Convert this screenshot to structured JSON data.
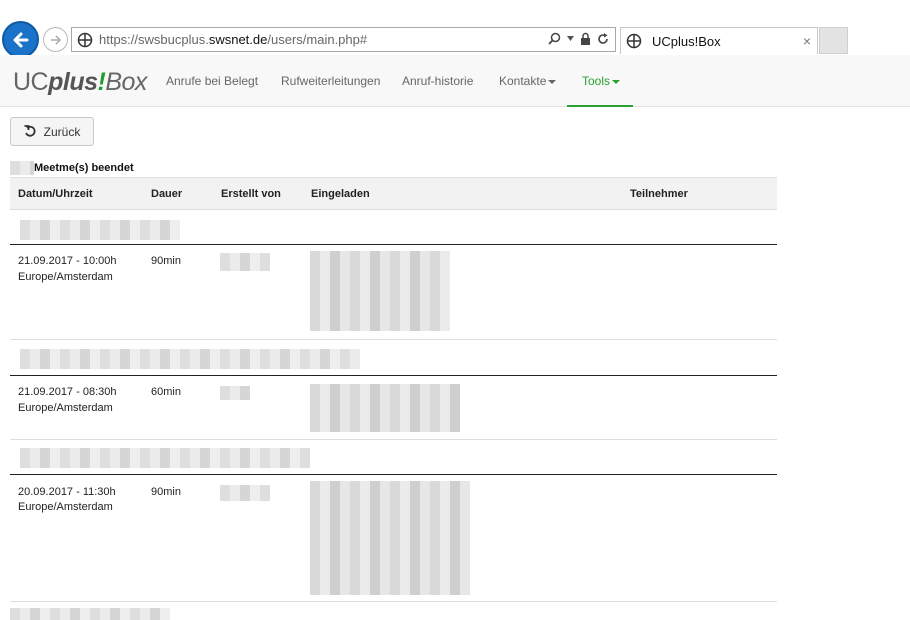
{
  "browser": {
    "url_prefix": "https://swsbucplus.",
    "url_host": "swsnet.de",
    "url_path": "/users/main.php#",
    "tab_title": "UCplus!Box",
    "tab_close": "×"
  },
  "brand": {
    "uc": "UC",
    "plus": "plus",
    "bang": "!",
    "box": "Box"
  },
  "menu": {
    "items": [
      {
        "label": "Anrufe bei Belegt"
      },
      {
        "label": "Rufweiterleitungen"
      },
      {
        "label": "Anruf-historie"
      },
      {
        "label": "Kontakte"
      },
      {
        "label": "Tools"
      }
    ],
    "accent": "#2aa12f"
  },
  "back_label": "Zurück",
  "section_title": "Meetme(s) beendet",
  "table": {
    "headers": [
      "Datum/Uhrzeit",
      "Dauer",
      "Erstellt von",
      "Eingeladen",
      "Teilnehmer"
    ],
    "rows": [
      {
        "date": "21.09.2017 - 10:00h",
        "tz": "Europe/Amsterdam",
        "duration": "90min"
      },
      {
        "date": "21.09.2017 - 08:30h",
        "tz": "Europe/Amsterdam",
        "duration": "60min"
      },
      {
        "date": "20.09.2017 - 11:30h",
        "tz": "Europe/Amsterdam",
        "duration": "90min"
      }
    ]
  }
}
